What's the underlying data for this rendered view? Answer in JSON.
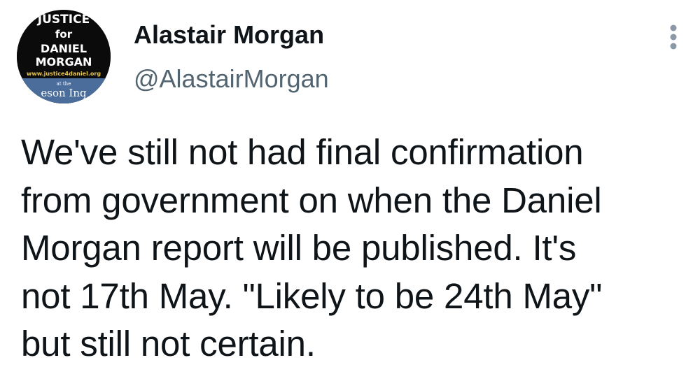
{
  "user": {
    "display_name": "Alastair Morgan",
    "handle": "@AlastairMorgan"
  },
  "avatar": {
    "line1": "JUSTICE",
    "line2": "for",
    "line3": "DANIEL",
    "line4": "MORGAN",
    "url": "www.justice4daniel.org",
    "small": "at the",
    "bottom": "eson Inq"
  },
  "tweet": {
    "text": "We've still not had final confirmation\nfrom government on when the Daniel\nMorgan report will be published. It's\nnot 17th May. \"Likely to be 24th  May\"\nbut still not certain."
  },
  "menu": {
    "icon": "more-vertical-icon"
  },
  "colors": {
    "text": "#0f1419",
    "secondary": "#536471",
    "avatar_bg": "#0b0b0b",
    "avatar_band": "#4a6d9c",
    "avatar_url": "#e8c64a"
  }
}
